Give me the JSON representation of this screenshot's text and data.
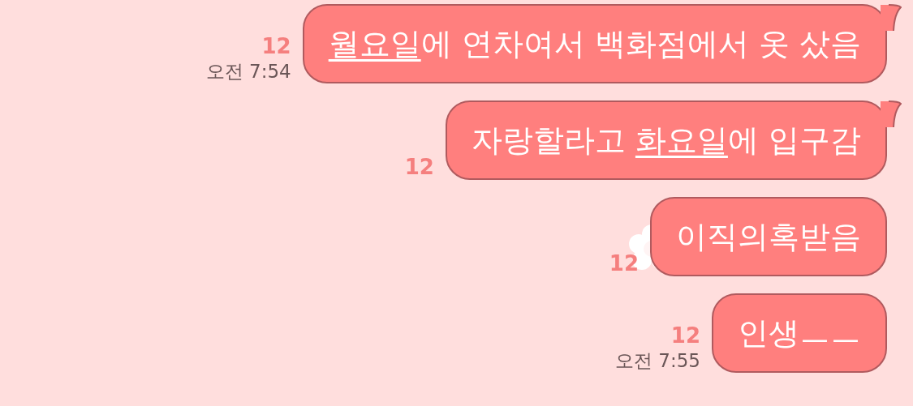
{
  "messages": [
    {
      "tail": true,
      "unread": "12",
      "time": "오전 7:54",
      "decoration": false,
      "segments": [
        {
          "text": "월요일",
          "link": true
        },
        {
          "text": "에 연차여서 백화점에서 옷 샀음",
          "link": false
        }
      ]
    },
    {
      "tail": true,
      "unread": "12",
      "decoration": false,
      "segments": [
        {
          "text": "자랑할라고 ",
          "link": false
        },
        {
          "text": "화요일",
          "link": true
        },
        {
          "text": "에 입구감",
          "link": false
        }
      ]
    },
    {
      "tail": false,
      "unread": "12",
      "decoration": true,
      "segments": [
        {
          "text": "이직의혹받음",
          "link": false
        }
      ]
    },
    {
      "tail": false,
      "unread": "12",
      "time": "오전 7:55",
      "decoration": false,
      "segments": [
        {
          "text": "인생ㅡㅡ",
          "link": false
        }
      ]
    }
  ]
}
